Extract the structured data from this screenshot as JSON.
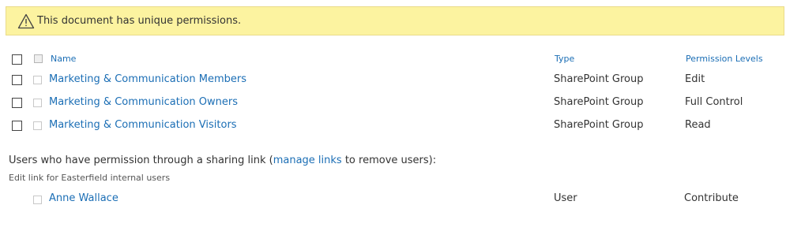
{
  "banner": {
    "icon": "warning-icon",
    "message": "This document has unique permissions."
  },
  "table": {
    "headers": {
      "name": "Name",
      "type": "Type",
      "permission": "Permission Levels"
    },
    "rows": [
      {
        "name": "Marketing & Communication Members",
        "type": "SharePoint Group",
        "permission": "Edit"
      },
      {
        "name": "Marketing & Communication Owners",
        "type": "SharePoint Group",
        "permission": "Full Control"
      },
      {
        "name": "Marketing & Communication Visitors",
        "type": "SharePoint Group",
        "permission": "Read"
      }
    ]
  },
  "sharing": {
    "text_before": "Users who have permission through a sharing link (",
    "link_label": "manage links",
    "text_after": " to remove users):",
    "link_type": "Edit link for Easterfield internal users",
    "users": [
      {
        "name": "Anne Wallace",
        "type": "User",
        "permission": "Contribute"
      }
    ]
  },
  "colors": {
    "banner_background": "#fcf3a0",
    "link": "#1b6eb5",
    "text": "#333333"
  }
}
